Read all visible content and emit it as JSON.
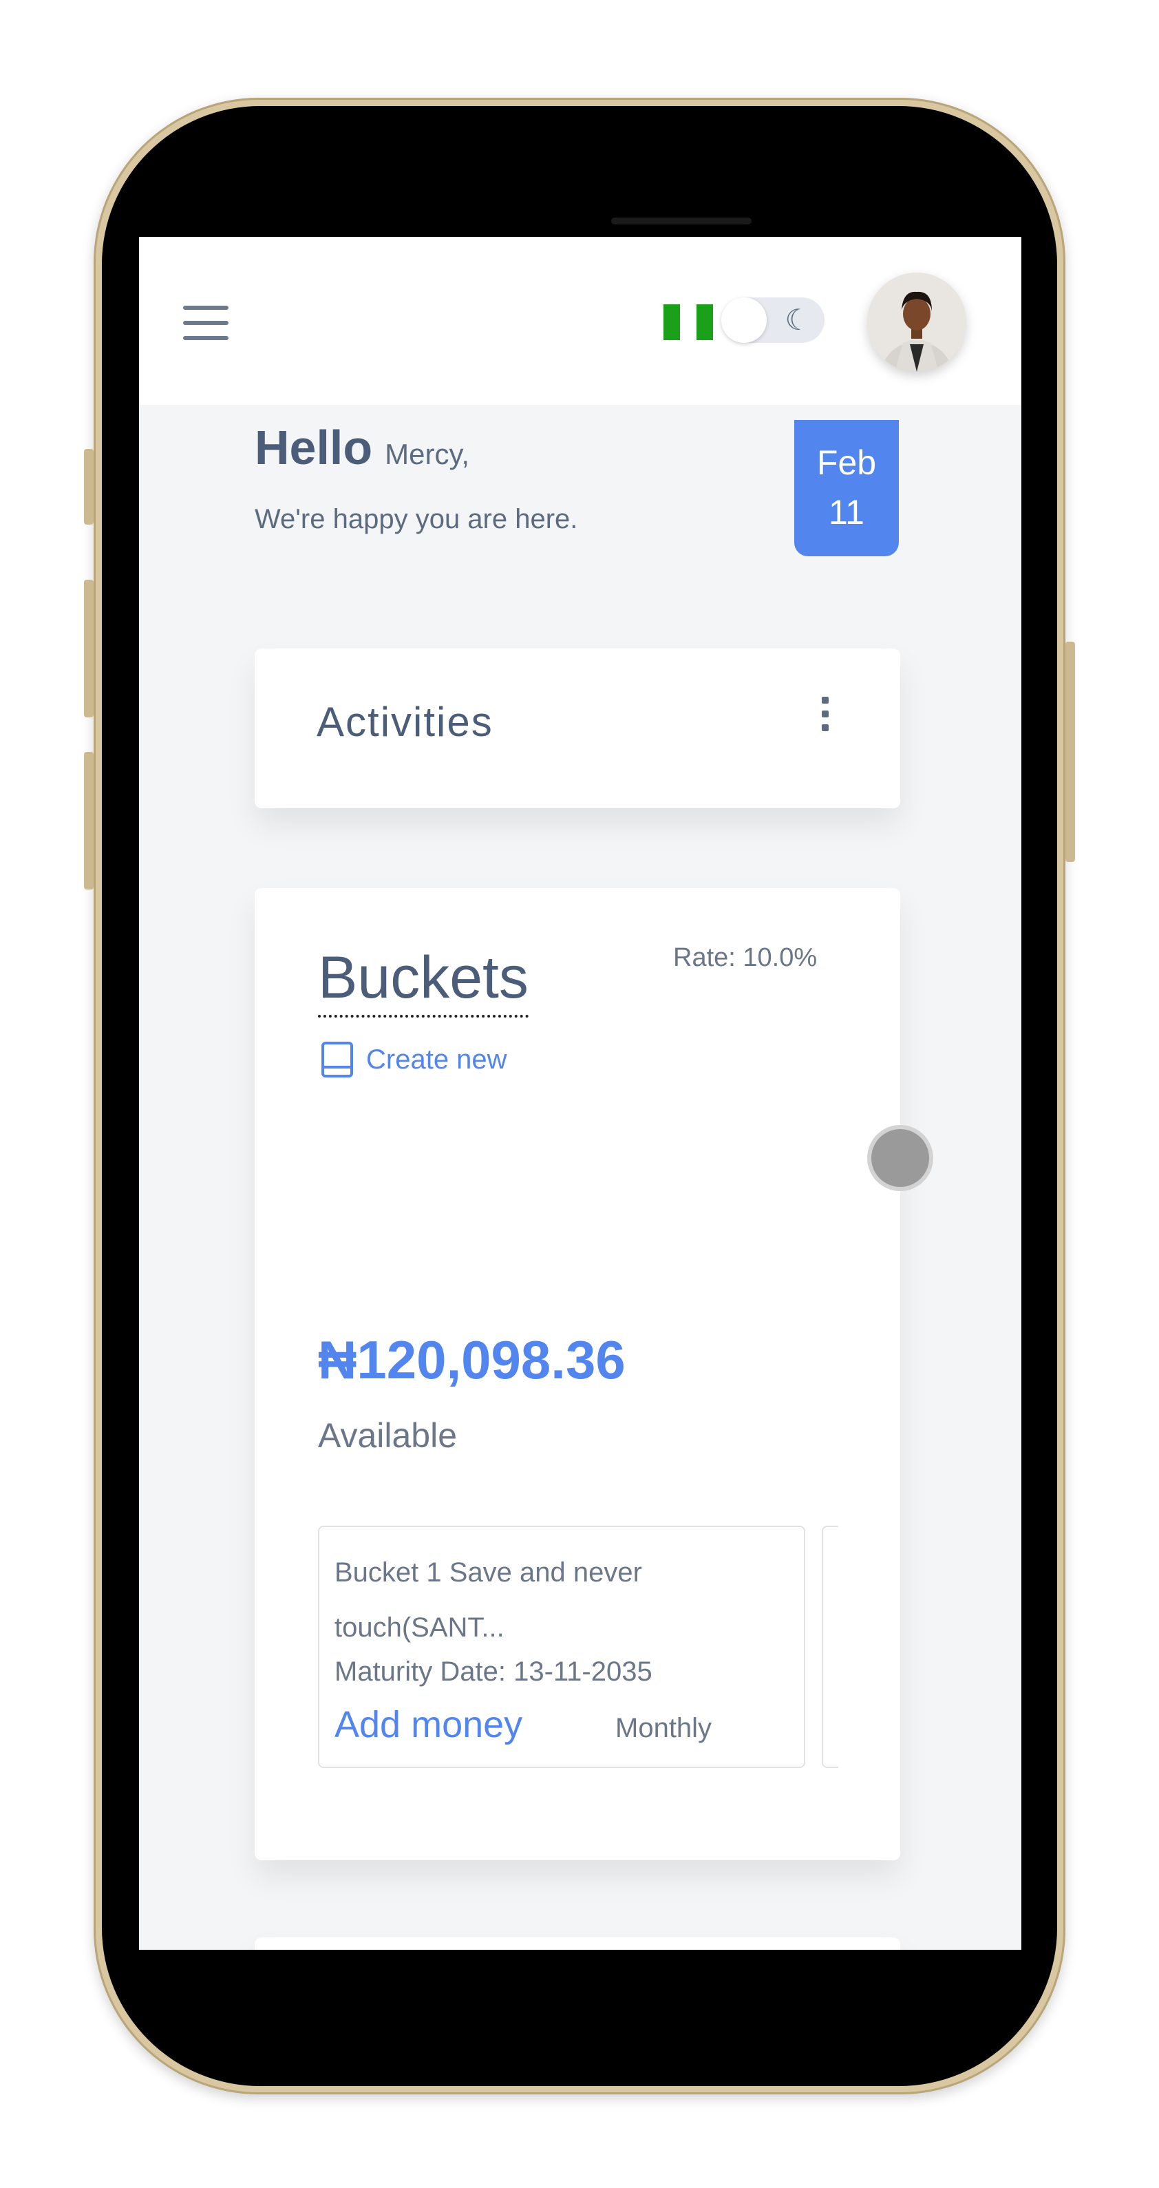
{
  "header": {
    "menu_icon": "hamburger-menu-icon",
    "flag_icon": "nigeria-flag-icon",
    "theme_toggle_icon": "moon-icon",
    "avatar_icon": "user-avatar"
  },
  "greeting": {
    "hello": "Hello",
    "name": "Mercy,",
    "subtitle": "We're happy you are here."
  },
  "date_badge": {
    "month": "Feb",
    "day": "11"
  },
  "activities": {
    "title": "Activities",
    "menu_icon": "kebab-menu-icon"
  },
  "buckets": {
    "title": "Buckets",
    "rate": "Rate: 10.0%",
    "create_icon": "book-icon",
    "create_label": "Create new",
    "amount": "₦120,098.36",
    "available_label": "Available",
    "items": [
      {
        "title": "Bucket 1 Save and never touch(SANT...",
        "maturity": "Maturity Date: 13-11-2035",
        "action": "Add money",
        "frequency": "Monthly"
      }
    ]
  },
  "colors": {
    "accent": "#5285ed",
    "text_primary": "#4b5d78",
    "text_secondary": "#6b7788",
    "flag_green": "#1aa119"
  }
}
